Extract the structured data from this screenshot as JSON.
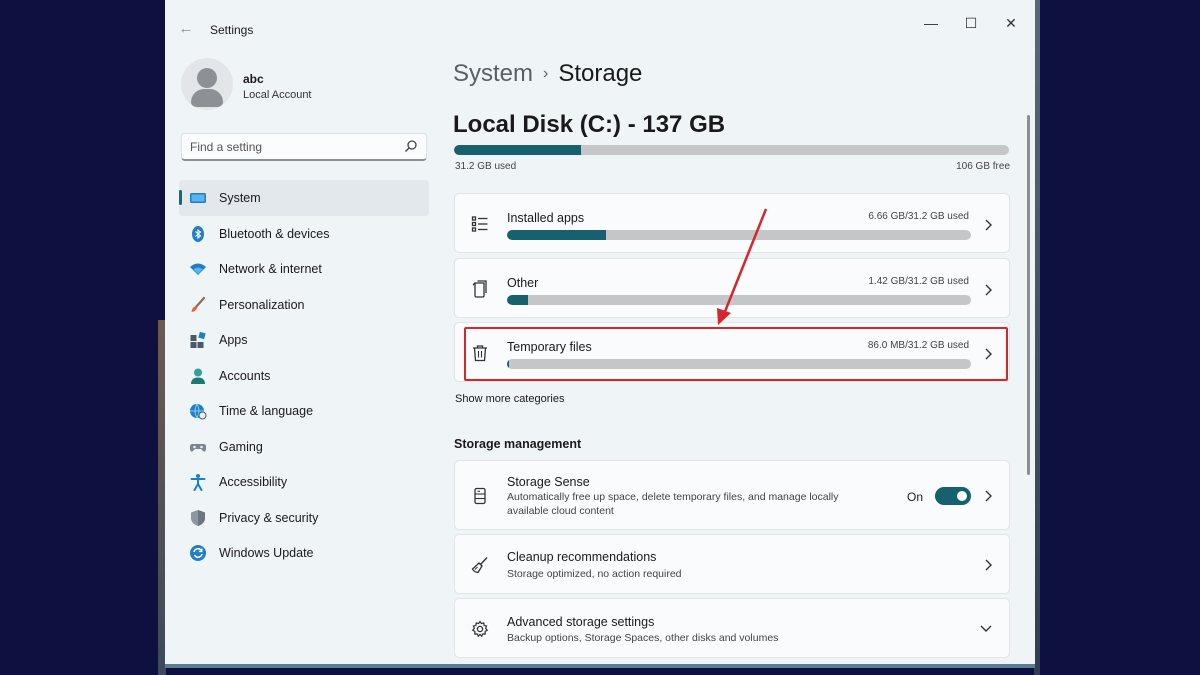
{
  "window": {
    "title": "Settings"
  },
  "profile": {
    "name": "abc",
    "account_type": "Local Account"
  },
  "search": {
    "placeholder": "Find a setting"
  },
  "sidebar": {
    "items": [
      {
        "label": "System",
        "icon": "monitor-icon",
        "active": true
      },
      {
        "label": "Bluetooth & devices",
        "icon": "bluetooth-icon"
      },
      {
        "label": "Network & internet",
        "icon": "wifi-icon"
      },
      {
        "label": "Personalization",
        "icon": "paintbrush-icon"
      },
      {
        "label": "Apps",
        "icon": "apps-icon"
      },
      {
        "label": "Accounts",
        "icon": "person-icon"
      },
      {
        "label": "Time & language",
        "icon": "globe-clock-icon"
      },
      {
        "label": "Gaming",
        "icon": "gamepad-icon"
      },
      {
        "label": "Accessibility",
        "icon": "accessibility-icon"
      },
      {
        "label": "Privacy & security",
        "icon": "shield-icon"
      },
      {
        "label": "Windows Update",
        "icon": "refresh-icon"
      }
    ]
  },
  "breadcrumb": {
    "parent": "System",
    "current": "Storage"
  },
  "disk": {
    "title": "Local Disk (C:) - 137 GB",
    "used_label": "31.2 GB used",
    "free_label": "106 GB free",
    "used_fraction": 0.228
  },
  "categories": [
    {
      "title": "Installed apps",
      "meta": "6.66 GB/31.2 GB used",
      "fraction": 0.213,
      "icon": "list-icon"
    },
    {
      "title": "Other",
      "meta": "1.42 GB/31.2 GB used",
      "fraction": 0.045,
      "icon": "document-icon"
    },
    {
      "title": "Temporary files",
      "meta": "86.0 MB/31.2 GB used",
      "fraction": 0.003,
      "icon": "trash-icon"
    }
  ],
  "show_more": "Show more categories",
  "storage_management": {
    "heading": "Storage management",
    "items": [
      {
        "title": "Storage Sense",
        "desc": "Automatically free up space, delete temporary files, and manage locally available cloud content",
        "toggle_label": "On",
        "icon": "drive-icon"
      },
      {
        "title": "Cleanup recommendations",
        "desc": "Storage optimized, no action required",
        "icon": "broom-icon"
      },
      {
        "title": "Advanced storage settings",
        "desc": "Backup options, Storage Spaces, other disks and volumes",
        "icon": "gear-icon"
      }
    ]
  },
  "colors": {
    "accent": "#17606e",
    "highlight": "#d7262b"
  }
}
